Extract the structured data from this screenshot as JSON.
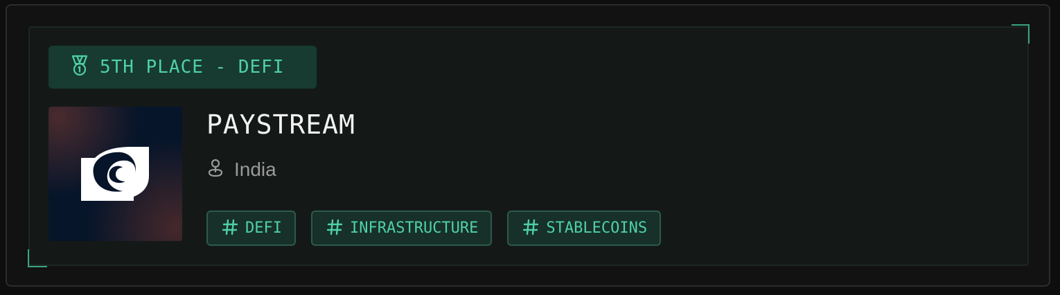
{
  "placement": {
    "label": "5TH PLACE - DEFI",
    "icon": "medal-icon"
  },
  "project": {
    "name": "PAYSTREAM",
    "logo": "paystream-logo",
    "location": "India",
    "location_icon": "map-pin-icon"
  },
  "tags": [
    {
      "label": "DEFI",
      "icon": "hash-icon"
    },
    {
      "label": "INFRASTRUCTURE",
      "icon": "hash-icon"
    },
    {
      "label": "STABLECOINS",
      "icon": "hash-icon"
    }
  ],
  "colors": {
    "accent": "#4fd1a5",
    "badge_bg": "#173b31",
    "card_bg": "#141917",
    "page_bg": "#0e0e0e"
  }
}
